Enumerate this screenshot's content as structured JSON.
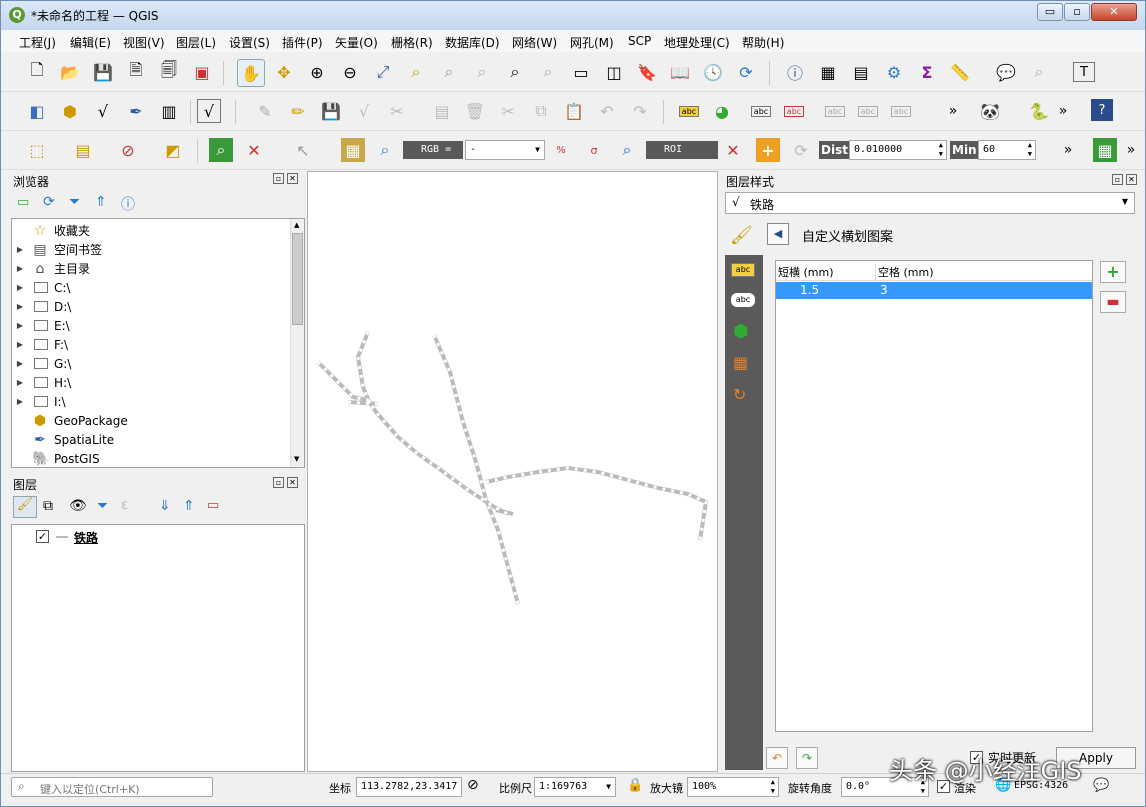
{
  "window": {
    "title": "*未命名的工程 — QGIS",
    "min": "▭",
    "max": "▫",
    "close": "✕"
  },
  "menus": [
    "工程(J)",
    "编辑(E)",
    "视图(V)",
    "图层(L)",
    "设置(S)",
    "插件(P)",
    "矢量(O)",
    "栅格(R)",
    "数据库(D)",
    "网络(W)",
    "网孔(M)",
    "SCP",
    "地理处理(C)",
    "帮助(H)"
  ],
  "toolbar3": {
    "rgb_label": "RGB =",
    "rgb_value": "-",
    "roi_label": "ROI",
    "dist_label": "Dist",
    "dist_value": "0.010000",
    "min_label": "Min",
    "min_value": "60",
    "more": "»"
  },
  "browser": {
    "title": "浏览器",
    "items": [
      {
        "label": "收藏夹",
        "icon": "star-icon",
        "arrow": ""
      },
      {
        "label": "空间书签",
        "icon": "bookmark-icon",
        "arrow": "▶"
      },
      {
        "label": "主目录",
        "icon": "home-icon",
        "arrow": "▶"
      },
      {
        "label": "C:\\",
        "icon": "folder-icon",
        "arrow": "▶"
      },
      {
        "label": "D:\\",
        "icon": "folder-icon",
        "arrow": "▶"
      },
      {
        "label": "E:\\",
        "icon": "folder-icon",
        "arrow": "▶"
      },
      {
        "label": "F:\\",
        "icon": "folder-icon",
        "arrow": "▶"
      },
      {
        "label": "G:\\",
        "icon": "folder-icon",
        "arrow": "▶"
      },
      {
        "label": "H:\\",
        "icon": "folder-icon",
        "arrow": "▶"
      },
      {
        "label": "I:\\",
        "icon": "folder-icon",
        "arrow": "▶"
      },
      {
        "label": "GeoPackage",
        "icon": "geopackage-icon",
        "arrow": ""
      },
      {
        "label": "SpatiaLite",
        "icon": "spatialite-icon",
        "arrow": ""
      },
      {
        "label": "PostGIS",
        "icon": "postgis-icon",
        "arrow": ""
      }
    ]
  },
  "layers": {
    "title": "图层",
    "items": [
      {
        "label": "铁路",
        "checked": true
      }
    ]
  },
  "style": {
    "title": "图层样式",
    "layer_select": "铁路",
    "section": "自定义横划图案",
    "col1": "短横 (mm)",
    "col2": "空格 (mm)",
    "rows": [
      {
        "dash": "1.5",
        "space": "3"
      }
    ],
    "live_update": "实时更新",
    "apply": "Apply"
  },
  "status": {
    "locate_placeholder": "键入以定位(Ctrl+K)",
    "coord_label": "坐标",
    "coord_value": "113.2782,23.3417",
    "scale_label": "比例尺",
    "scale_value": "1:169763",
    "mag_label": "放大镜",
    "mag_value": "100%",
    "rot_label": "旋转角度",
    "rot_value": "0.0°",
    "render_label": "渲染",
    "crs": "EPSG:4326"
  },
  "watermark": "头条 @小经注GIS"
}
